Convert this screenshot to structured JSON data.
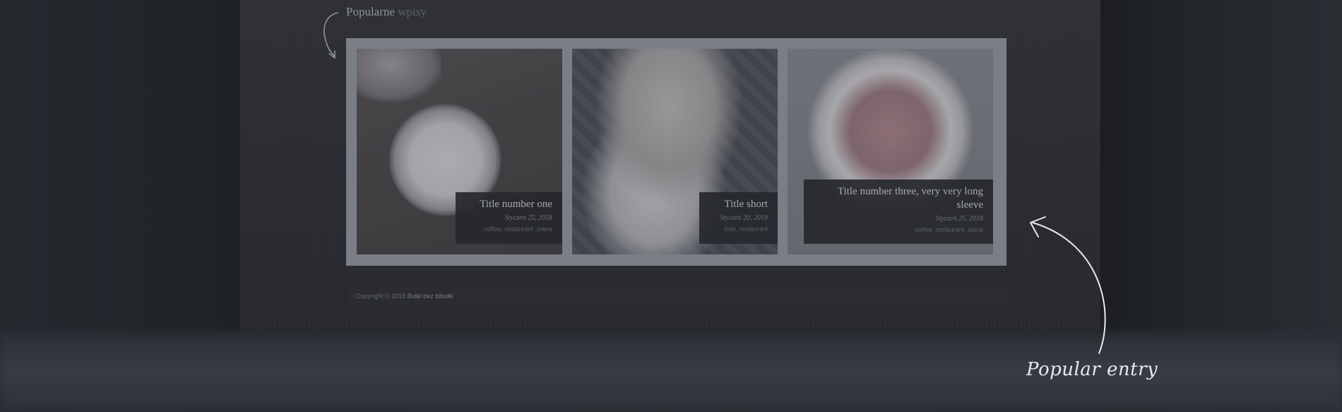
{
  "section": {
    "title_main": "Popularne",
    "title_accent": "wpisy"
  },
  "posts": [
    {
      "title": "Title number one",
      "date": "Styczeń 25, 2018",
      "tags": "coffee, restaurant, piana",
      "image": "coffee-cup-photo"
    },
    {
      "title": "Title short",
      "date": "Styczeń 20, 2018",
      "tags": "lody, restaurant",
      "image": "ice-cream-cone-photo"
    },
    {
      "title": "Title number three, very very long sleeve",
      "date": "Styczeń 25, 2018",
      "tags": "coffee, restaurant, piana",
      "image": "strawberry-cake-photo"
    }
  ],
  "footer": {
    "copyright": "Copyright © 2018 ",
    "brand": "Butki bez bibułki"
  },
  "callout": {
    "label": "Popular entry"
  },
  "colors": {
    "background": "#24272c",
    "gallery_frame": "#7a7e86",
    "caption_bg": "#26282d",
    "callout_text": "#e8e9ec"
  }
}
